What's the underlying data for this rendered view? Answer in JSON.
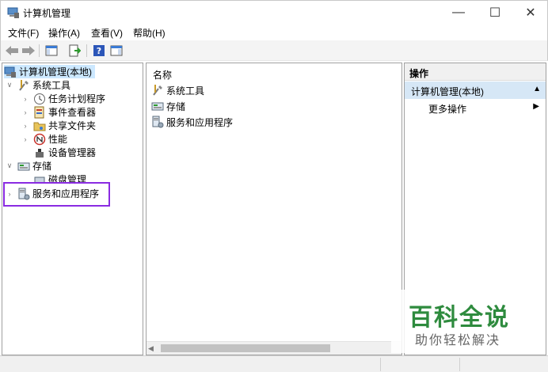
{
  "window": {
    "title": "计算机管理",
    "min_glyph": "—",
    "max_glyph": "☐",
    "close_glyph": "✕"
  },
  "menu": [
    {
      "label": "文件(F)"
    },
    {
      "label": "操作(A)"
    },
    {
      "label": "查看(V)"
    },
    {
      "label": "帮助(H)"
    }
  ],
  "toolbar": {
    "buttons": [
      "back-icon",
      "forward-icon",
      "show-hide-console-tree-icon",
      "export-list-icon",
      "help-icon",
      "show-hide-action-pane-icon"
    ]
  },
  "tree": {
    "root": "计算机管理(本地)",
    "system_tools": "系统工具",
    "task_scheduler": "任务计划程序",
    "event_viewer": "事件查看器",
    "shared_folders": "共享文件夹",
    "performance": "性能",
    "device_manager": "设备管理器",
    "storage": "存储",
    "disk_management": "磁盘管理",
    "services_apps": "服务和应用程序"
  },
  "list": {
    "column_name": "名称",
    "items": [
      "系统工具",
      "存储",
      "服务和应用程序"
    ]
  },
  "actions": {
    "header": "操作",
    "group": "计算机管理(本地)",
    "more": "更多操作"
  },
  "watermark": {
    "title": "百科全说",
    "subtitle": "助你轻松解决"
  },
  "colors": {
    "selection": "#cce8ff",
    "highlight_box": "#8a2be2",
    "action_group_bg": "#d6e7f6",
    "watermark_green": "#2e8b3e"
  }
}
